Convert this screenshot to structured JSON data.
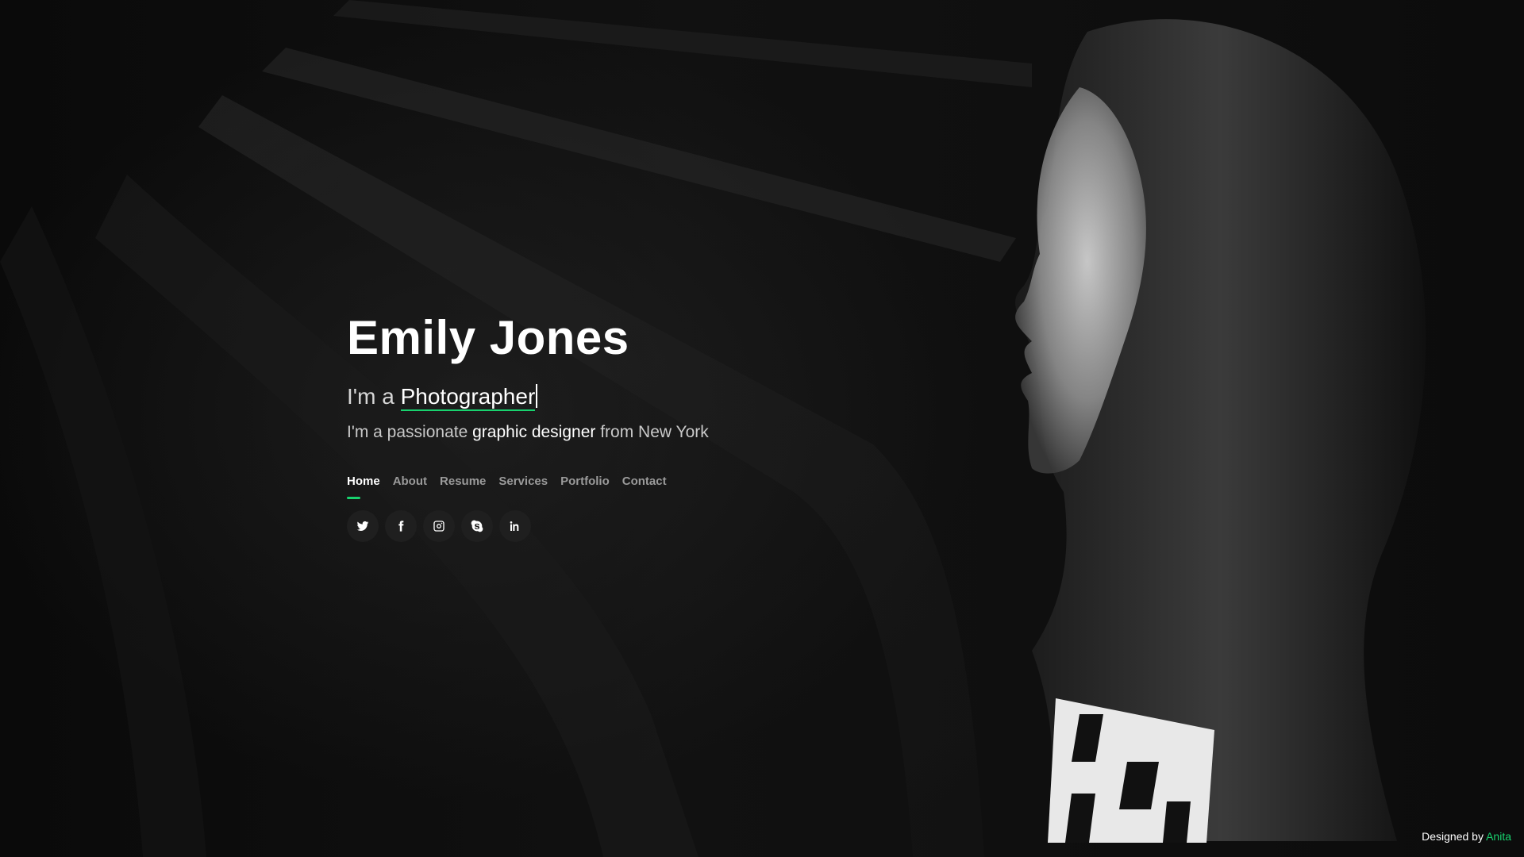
{
  "hero": {
    "name": "Emily Jones",
    "typed_prefix": "I'm a ",
    "typed_word": "Photographer",
    "tagline_prefix": "I'm a passionate ",
    "tagline_highlight": "graphic designer",
    "tagline_suffix": " from New York"
  },
  "nav": {
    "items": [
      {
        "label": "Home",
        "active": true
      },
      {
        "label": "About"
      },
      {
        "label": "Resume"
      },
      {
        "label": "Services"
      },
      {
        "label": "Portfolio"
      },
      {
        "label": "Contact"
      }
    ]
  },
  "social": {
    "icons": [
      "twitter-icon",
      "facebook-icon",
      "instagram-icon",
      "skype-icon",
      "linkedin-icon"
    ]
  },
  "credits": {
    "prefix": "Designed by ",
    "author": "Anita"
  },
  "colors": {
    "accent": "#18d26e",
    "background": "#0b0b0b",
    "text": "#ffffff",
    "nav_inactive": "#9a9a9a",
    "social_bg": "#1f1f1f"
  }
}
